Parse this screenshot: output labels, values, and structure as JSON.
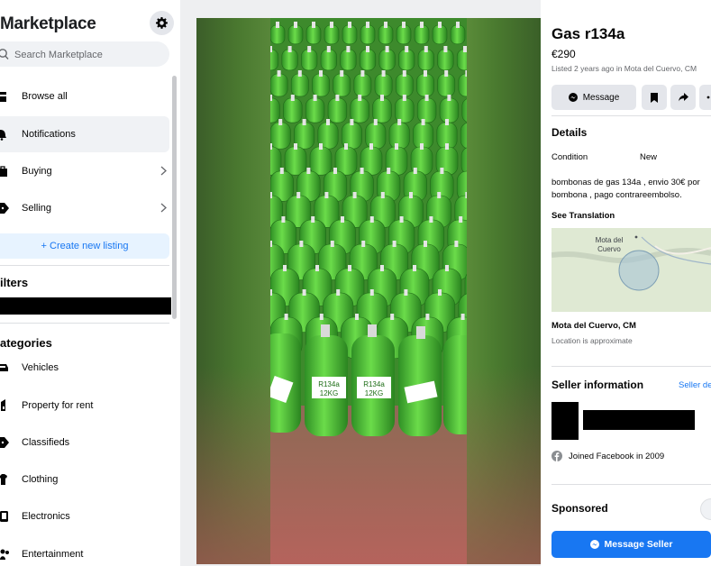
{
  "sidebar": {
    "title": "Marketplace",
    "search_placeholder": "Search Marketplace",
    "nav": [
      {
        "label": "Browse all",
        "icon": "storefront-icon"
      },
      {
        "label": "Notifications",
        "icon": "bell-icon"
      },
      {
        "label": "Buying",
        "icon": "shopping-bag-icon"
      },
      {
        "label": "Selling",
        "icon": "tag-icon"
      }
    ],
    "create_listing": "+ Create new listing",
    "filters_heading": "ilters",
    "categories_heading": "ategories",
    "categories": [
      {
        "label": "Vehicles",
        "icon": "car-icon"
      },
      {
        "label": "Property for rent",
        "icon": "building-icon"
      },
      {
        "label": "Classifieds",
        "icon": "tag-icon"
      },
      {
        "label": "Clothing",
        "icon": "shirt-icon"
      },
      {
        "label": "Electronics",
        "icon": "phone-icon"
      },
      {
        "label": "Entertainment",
        "icon": "people-icon"
      }
    ]
  },
  "listing": {
    "title": "Gas r134a",
    "price": "€290",
    "listed": "Listed 2 years ago in Mota del Cuervo, CM",
    "message_button": "Message",
    "details_heading": "Details",
    "condition_label": "Condition",
    "condition_value": "New",
    "description": "bombonas de gas 134a , envio 30€ por bombona , pago contrareembolso.",
    "see_translation": "See Translation",
    "map_label": "Mota del Cuervo",
    "location": "Mota del Cuervo, CM",
    "location_note": "Location is approximate",
    "seller_heading": "Seller information",
    "seller_details_link": "Seller de",
    "joined": "Joined Facebook in 2009",
    "sponsored_heading": "Sponsored",
    "message_seller_button": "Message Seller"
  },
  "photo": {
    "cylinder_label_line1": "R134a",
    "cylinder_label_line2": "12KG"
  },
  "colors": {
    "accent": "#1877f2",
    "cylinder_green": "#4fc23a",
    "floor": "#a8625a"
  }
}
